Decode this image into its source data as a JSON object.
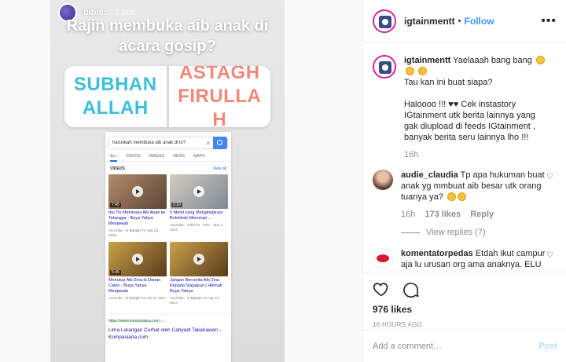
{
  "story": {
    "username": "bibiss",
    "time": "2 jam",
    "question": "Rajin membuka aib anak di acara gosip?",
    "poll_option_a": "SUBHANALLAH",
    "poll_option_b": "ASTAGHFIRULLAH"
  },
  "screenshot": {
    "query": "haruskah membuka aib anak di tv?",
    "tabs": [
      "ALL",
      "VIDEOS",
      "IMAGES",
      "NEWS",
      "MAPS"
    ],
    "videos_heading": "VIDEOS",
    "view_all": "View all",
    "videos": [
      {
        "duration": "7:45",
        "title": "Ibu Tiri Membuka Aib Anak ke Tetangga - Buya Yahya Menjawab",
        "meta": "YouTube · Al Bahjah TV\nSep 23, 2018"
      },
      {
        "duration": "2:10",
        "title": "5 Menit yang Menginspirasi: Bolehkah Menutupi ...",
        "meta": "YouTube · Yufid TV · Pen...\nMar 1, 2017"
      },
      {
        "duration": "5:45",
        "title": "Menutup Aib Zina di Depan Calon - Buya Yahya Menjawab",
        "meta": "YouTube · Al Bahjah TV\nJul 19, 2017"
      },
      {
        "duration": "",
        "title": "Jangan Bercerita Aib Zina Kepada Siapapun | Hikmah Buya Yahya",
        "meta": "YouTube · Al Bahjah TV\nApr 14, 2017"
      }
    ],
    "link_url": "https://www.kompasiana.com ›...",
    "link_title": "Lima Larangan Curhat oleh Cahyadi Takariawan - Kompasiana.com"
  },
  "header": {
    "username": "igtainmentt",
    "separator": "•",
    "follow": "Follow",
    "more": "•••"
  },
  "caption": {
    "username": "igtainmentt",
    "text_1": "Yaelaaah bang bang",
    "text_2": "Tau kan ini buat siapa?",
    "text_3": "Haloooo !!! ♥♥ Cek instastory IGtainment utk berita lainnya yang gak diupload di feeds IGtainment , banyak berita seru lainnya lho !!!",
    "time": "16h"
  },
  "comments": [
    {
      "username": "audie_claudia",
      "text": "Tp apa hukuman buat anak yg mmbuat aib besar utk orang tuanya ya?",
      "time": "16h",
      "likes": "173 likes",
      "reply": "Reply",
      "view_replies": "View replies (7)"
    },
    {
      "username": "komentatorpedas",
      "text": "Etdah ikut campur aja lu urusan org ama anaknya. ELU SIAPA TONG???"
    }
  ],
  "actions": {
    "likes": "976 likes",
    "ago": "16 HOURS AGO"
  },
  "add_comment": {
    "placeholder": "Add a comment…",
    "post": "Post"
  }
}
